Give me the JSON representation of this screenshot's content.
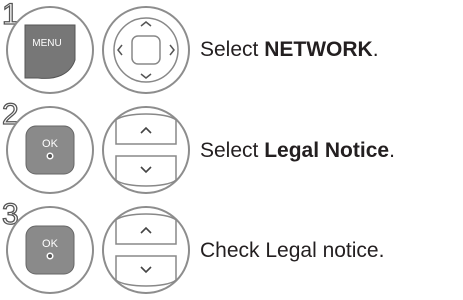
{
  "steps": [
    {
      "number": "1",
      "buttons": [
        "MENU",
        "navigation pad"
      ],
      "text_prefix": "Select ",
      "text_bold": "NETWORK",
      "text_suffix": "."
    },
    {
      "number": "2",
      "buttons": [
        "OK",
        "up/down"
      ],
      "text_prefix": "Select ",
      "text_bold": "Legal Notice",
      "text_suffix": "."
    },
    {
      "number": "3",
      "buttons": [
        "OK",
        "up/down"
      ],
      "text_prefix": "Check Legal notice.",
      "text_bold": "",
      "text_suffix": ""
    }
  ],
  "menu_key_label": "MENU",
  "ok_key_label": "OK"
}
